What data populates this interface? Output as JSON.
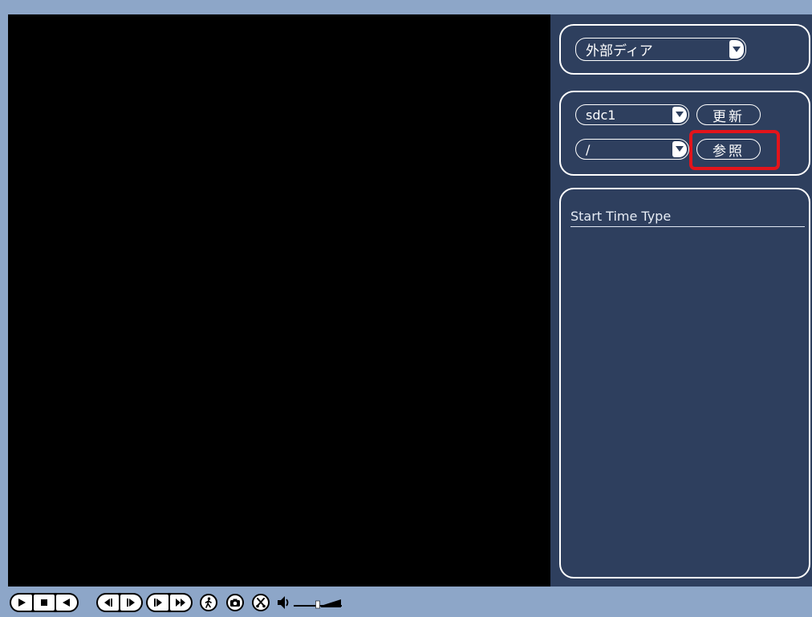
{
  "colors": {
    "frame_bg": "#8da6c8",
    "video_bg": "#000000",
    "panel_bg": "#2e3f5e",
    "outline": "#ffffff",
    "highlight": "#e3141b"
  },
  "storage_panel": {
    "device_select": {
      "value": "外部ディア",
      "icon": "chevron-down-icon"
    }
  },
  "disk_panel": {
    "disk_select": {
      "value": "sdc1",
      "icon": "chevron-down-icon"
    },
    "refresh_button": {
      "label": "更新"
    },
    "path_select": {
      "value": "/",
      "icon": "chevron-down-icon"
    },
    "browse_button": {
      "label": "参照",
      "highlighted": true
    }
  },
  "file_list": {
    "header": "Start Time Type"
  },
  "toolbar": {
    "playback_group": [
      {
        "icon": "play-icon"
      },
      {
        "icon": "stop-icon"
      },
      {
        "icon": "reverse-play-icon"
      }
    ],
    "frame_group": [
      {
        "icon": "previous-frame-icon"
      },
      {
        "icon": "next-frame-icon"
      }
    ],
    "speed_group": [
      {
        "icon": "slow-play-icon"
      },
      {
        "icon": "fast-play-icon"
      }
    ],
    "tools": [
      {
        "icon": "smart-search-icon"
      },
      {
        "icon": "snapshot-icon"
      },
      {
        "icon": "clip-icon"
      }
    ],
    "volume": {
      "icon": "speaker-icon",
      "level": 0.5
    }
  }
}
